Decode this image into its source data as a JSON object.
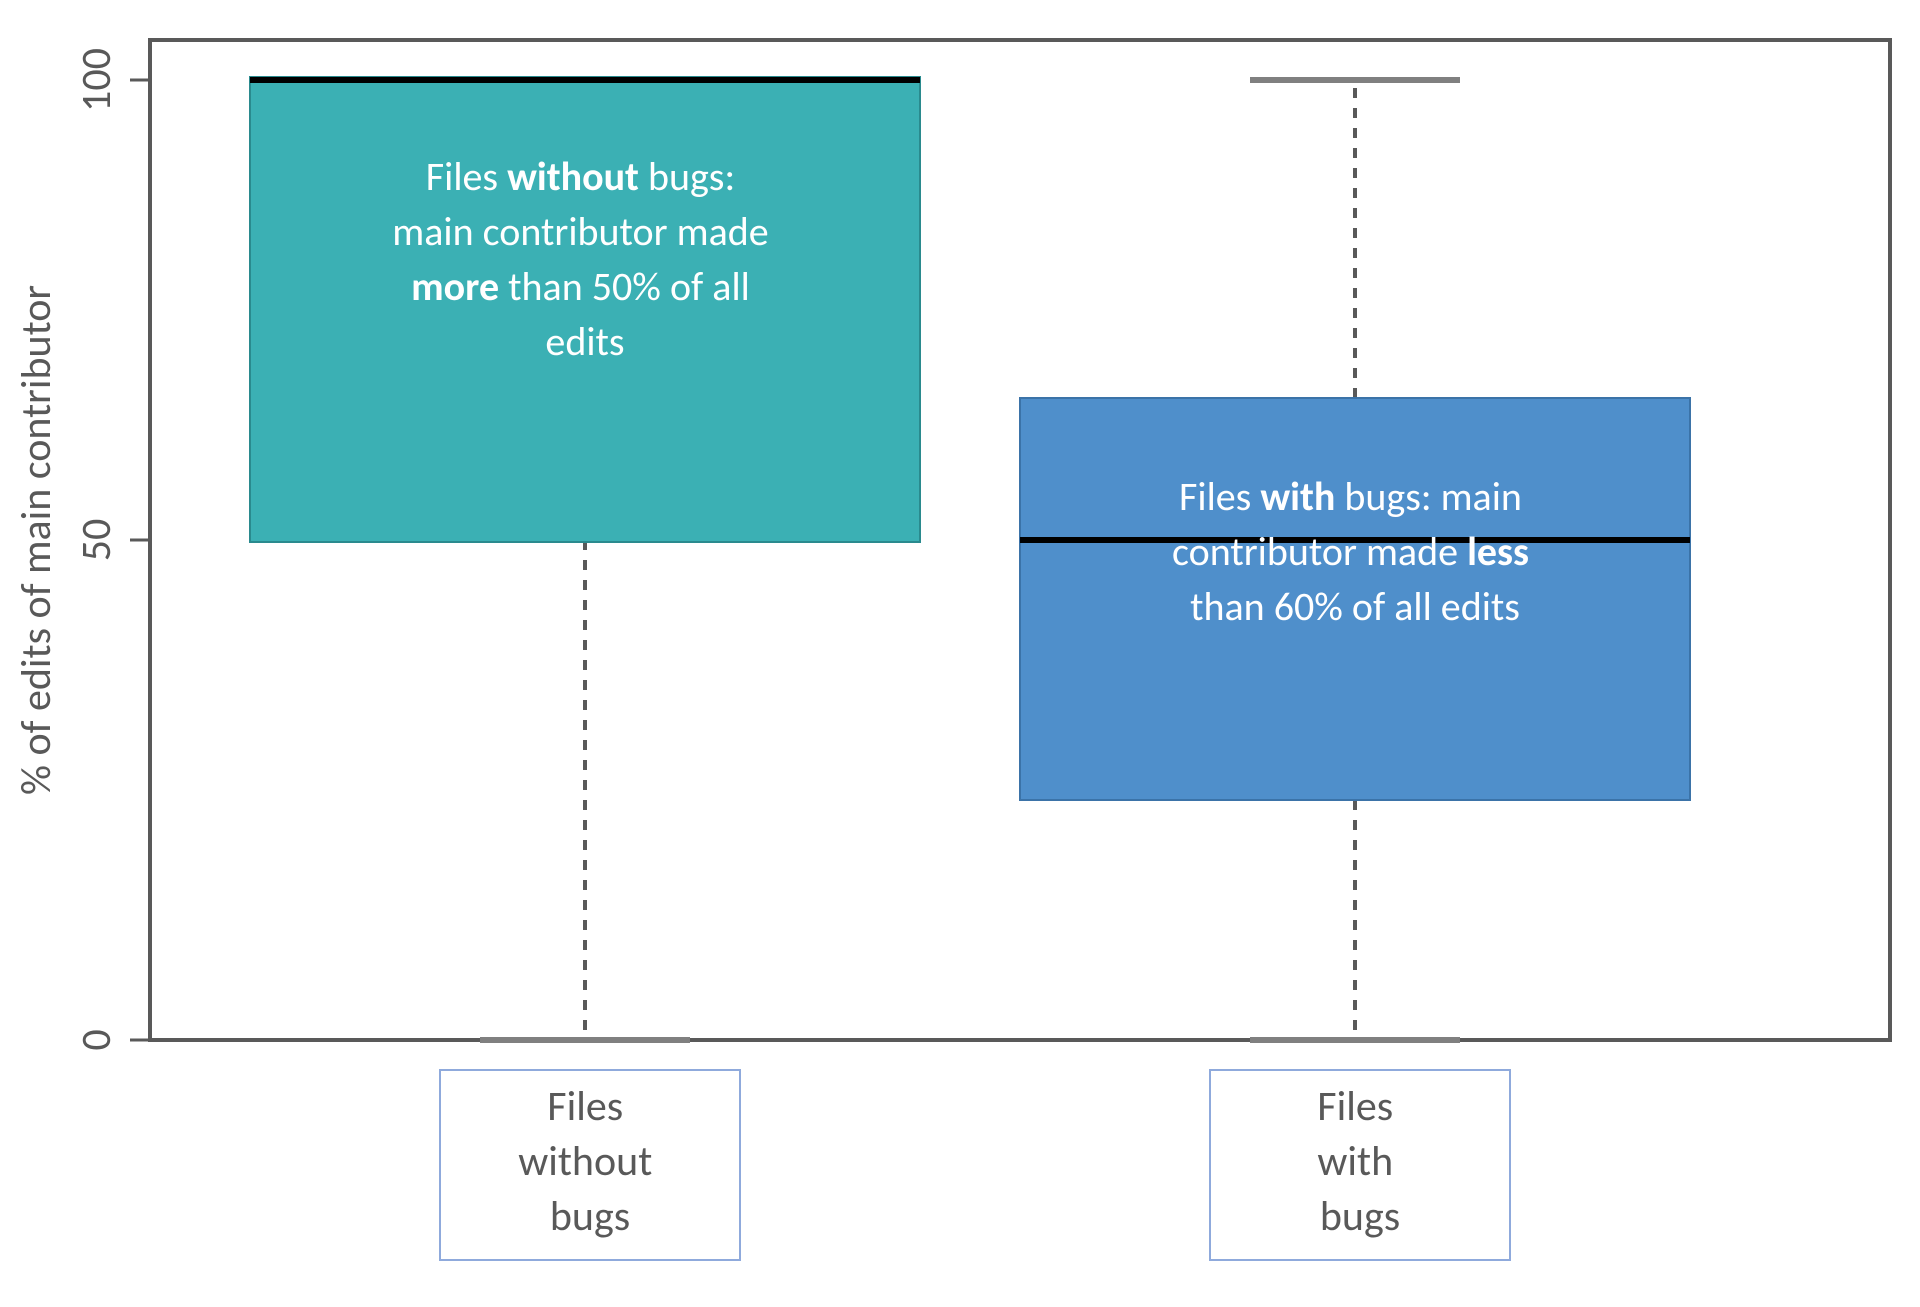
{
  "chart_data": {
    "type": "boxplot",
    "ylabel": "% of edits of main contributor",
    "y_ticks": [
      0,
      50,
      100
    ],
    "ylim": [
      0,
      100
    ],
    "series": [
      {
        "name": "Files without bugs",
        "color": "#3BB0B4",
        "min": 0,
        "q1": 50,
        "median": 100,
        "q3": 100,
        "max": 100,
        "annotation": {
          "pre": "Files ",
          "b1": "without",
          "mid1": " bugs:",
          "line2a": "main contributor made",
          "b2": "more",
          "mid2": " than 50% of all",
          "last": "edits"
        }
      },
      {
        "name": "Files with bugs",
        "color": "#4F8FCB",
        "min": 0,
        "q1": 25,
        "median": 50,
        "q3": 67,
        "max": 100,
        "annotation": {
          "pre": "Files ",
          "b1": "with",
          "mid1": " bugs: main",
          "line2a": "contributor made ",
          "b2": "less",
          "mid2": "",
          "last": "than 60% of all edits"
        }
      }
    ],
    "xcat_lines": {
      "0": [
        "Files",
        "without",
        "bugs"
      ],
      "1": [
        "Files",
        "with",
        "bugs"
      ]
    }
  }
}
